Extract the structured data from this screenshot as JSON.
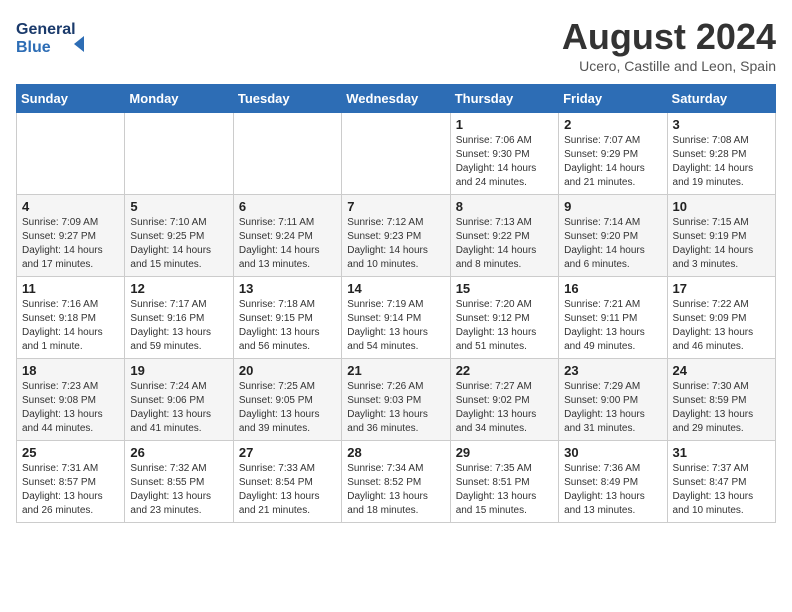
{
  "header": {
    "logo_line1": "General",
    "logo_line2": "Blue",
    "month": "August 2024",
    "location": "Ucero, Castille and Leon, Spain"
  },
  "weekdays": [
    "Sunday",
    "Monday",
    "Tuesday",
    "Wednesday",
    "Thursday",
    "Friday",
    "Saturday"
  ],
  "weeks": [
    [
      {
        "day": "",
        "info": ""
      },
      {
        "day": "",
        "info": ""
      },
      {
        "day": "",
        "info": ""
      },
      {
        "day": "",
        "info": ""
      },
      {
        "day": "1",
        "info": "Sunrise: 7:06 AM\nSunset: 9:30 PM\nDaylight: 14 hours\nand 24 minutes."
      },
      {
        "day": "2",
        "info": "Sunrise: 7:07 AM\nSunset: 9:29 PM\nDaylight: 14 hours\nand 21 minutes."
      },
      {
        "day": "3",
        "info": "Sunrise: 7:08 AM\nSunset: 9:28 PM\nDaylight: 14 hours\nand 19 minutes."
      }
    ],
    [
      {
        "day": "4",
        "info": "Sunrise: 7:09 AM\nSunset: 9:27 PM\nDaylight: 14 hours\nand 17 minutes."
      },
      {
        "day": "5",
        "info": "Sunrise: 7:10 AM\nSunset: 9:25 PM\nDaylight: 14 hours\nand 15 minutes."
      },
      {
        "day": "6",
        "info": "Sunrise: 7:11 AM\nSunset: 9:24 PM\nDaylight: 14 hours\nand 13 minutes."
      },
      {
        "day": "7",
        "info": "Sunrise: 7:12 AM\nSunset: 9:23 PM\nDaylight: 14 hours\nand 10 minutes."
      },
      {
        "day": "8",
        "info": "Sunrise: 7:13 AM\nSunset: 9:22 PM\nDaylight: 14 hours\nand 8 minutes."
      },
      {
        "day": "9",
        "info": "Sunrise: 7:14 AM\nSunset: 9:20 PM\nDaylight: 14 hours\nand 6 minutes."
      },
      {
        "day": "10",
        "info": "Sunrise: 7:15 AM\nSunset: 9:19 PM\nDaylight: 14 hours\nand 3 minutes."
      }
    ],
    [
      {
        "day": "11",
        "info": "Sunrise: 7:16 AM\nSunset: 9:18 PM\nDaylight: 14 hours\nand 1 minute."
      },
      {
        "day": "12",
        "info": "Sunrise: 7:17 AM\nSunset: 9:16 PM\nDaylight: 13 hours\nand 59 minutes."
      },
      {
        "day": "13",
        "info": "Sunrise: 7:18 AM\nSunset: 9:15 PM\nDaylight: 13 hours\nand 56 minutes."
      },
      {
        "day": "14",
        "info": "Sunrise: 7:19 AM\nSunset: 9:14 PM\nDaylight: 13 hours\nand 54 minutes."
      },
      {
        "day": "15",
        "info": "Sunrise: 7:20 AM\nSunset: 9:12 PM\nDaylight: 13 hours\nand 51 minutes."
      },
      {
        "day": "16",
        "info": "Sunrise: 7:21 AM\nSunset: 9:11 PM\nDaylight: 13 hours\nand 49 minutes."
      },
      {
        "day": "17",
        "info": "Sunrise: 7:22 AM\nSunset: 9:09 PM\nDaylight: 13 hours\nand 46 minutes."
      }
    ],
    [
      {
        "day": "18",
        "info": "Sunrise: 7:23 AM\nSunset: 9:08 PM\nDaylight: 13 hours\nand 44 minutes."
      },
      {
        "day": "19",
        "info": "Sunrise: 7:24 AM\nSunset: 9:06 PM\nDaylight: 13 hours\nand 41 minutes."
      },
      {
        "day": "20",
        "info": "Sunrise: 7:25 AM\nSunset: 9:05 PM\nDaylight: 13 hours\nand 39 minutes."
      },
      {
        "day": "21",
        "info": "Sunrise: 7:26 AM\nSunset: 9:03 PM\nDaylight: 13 hours\nand 36 minutes."
      },
      {
        "day": "22",
        "info": "Sunrise: 7:27 AM\nSunset: 9:02 PM\nDaylight: 13 hours\nand 34 minutes."
      },
      {
        "day": "23",
        "info": "Sunrise: 7:29 AM\nSunset: 9:00 PM\nDaylight: 13 hours\nand 31 minutes."
      },
      {
        "day": "24",
        "info": "Sunrise: 7:30 AM\nSunset: 8:59 PM\nDaylight: 13 hours\nand 29 minutes."
      }
    ],
    [
      {
        "day": "25",
        "info": "Sunrise: 7:31 AM\nSunset: 8:57 PM\nDaylight: 13 hours\nand 26 minutes."
      },
      {
        "day": "26",
        "info": "Sunrise: 7:32 AM\nSunset: 8:55 PM\nDaylight: 13 hours\nand 23 minutes."
      },
      {
        "day": "27",
        "info": "Sunrise: 7:33 AM\nSunset: 8:54 PM\nDaylight: 13 hours\nand 21 minutes."
      },
      {
        "day": "28",
        "info": "Sunrise: 7:34 AM\nSunset: 8:52 PM\nDaylight: 13 hours\nand 18 minutes."
      },
      {
        "day": "29",
        "info": "Sunrise: 7:35 AM\nSunset: 8:51 PM\nDaylight: 13 hours\nand 15 minutes."
      },
      {
        "day": "30",
        "info": "Sunrise: 7:36 AM\nSunset: 8:49 PM\nDaylight: 13 hours\nand 13 minutes."
      },
      {
        "day": "31",
        "info": "Sunrise: 7:37 AM\nSunset: 8:47 PM\nDaylight: 13 hours\nand 10 minutes."
      }
    ]
  ]
}
